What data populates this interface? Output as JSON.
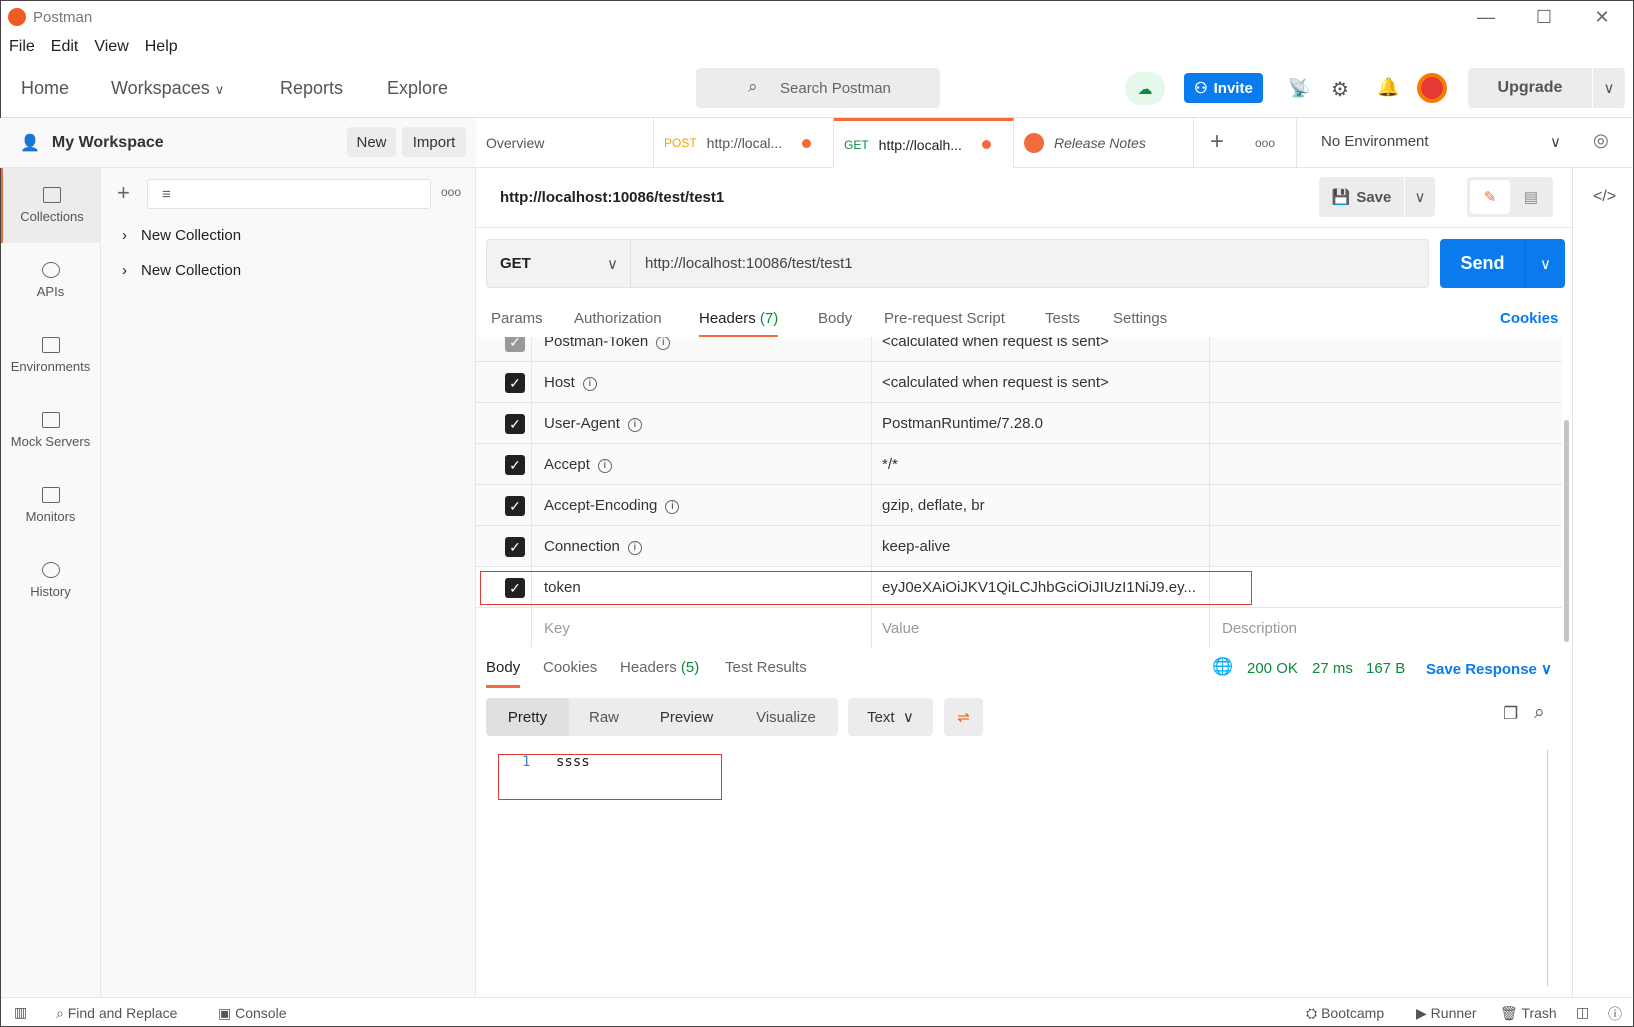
{
  "app": {
    "title": "Postman"
  },
  "menu": [
    "File",
    "Edit",
    "View",
    "Help"
  ],
  "nav": {
    "home": "Home",
    "workspaces": "Workspaces",
    "reports": "Reports",
    "explore": "Explore",
    "search_placeholder": "Search Postman",
    "invite": "Invite",
    "upgrade": "Upgrade"
  },
  "workspace": {
    "name": "My Workspace",
    "new": "New",
    "import": "Import"
  },
  "sidebar": [
    {
      "label": "Collections",
      "icon": "collections-icon"
    },
    {
      "label": "APIs",
      "icon": "apis-icon"
    },
    {
      "label": "Environments",
      "icon": "environments-icon"
    },
    {
      "label": "Mock Servers",
      "icon": "mock-servers-icon"
    },
    {
      "label": "Monitors",
      "icon": "monitors-icon"
    },
    {
      "label": "History",
      "icon": "history-icon"
    }
  ],
  "collections": [
    "New Collection",
    "New Collection"
  ],
  "tabs": [
    {
      "label": "Overview"
    },
    {
      "method": "POST",
      "label": "http://local..."
    },
    {
      "method": "GET",
      "label": "http://localh..."
    },
    {
      "label": "Release Notes"
    }
  ],
  "environment": "No Environment",
  "request": {
    "title": "http://localhost:10086/test/test1",
    "method": "GET",
    "url": "http://localhost:10086/test/test1",
    "save": "Save",
    "send": "Send"
  },
  "request_tabs": {
    "params": "Params",
    "authorization": "Authorization",
    "headers": "Headers",
    "headers_count": "(7)",
    "body": "Body",
    "prerequest": "Pre-request Script",
    "tests": "Tests",
    "settings": "Settings",
    "cookies": "Cookies"
  },
  "headers": [
    {
      "key": "Postman-Token",
      "value": "<calculated when request is sent>"
    },
    {
      "key": "Host",
      "value": "<calculated when request is sent>"
    },
    {
      "key": "User-Agent",
      "value": "PostmanRuntime/7.28.0"
    },
    {
      "key": "Accept",
      "value": "*/*"
    },
    {
      "key": "Accept-Encoding",
      "value": "gzip, deflate, br"
    },
    {
      "key": "Connection",
      "value": "keep-alive"
    },
    {
      "key": "token",
      "value": "eyJ0eXAiOiJKV1QiLCJhbGciOiJIUzI1NiJ9.ey..."
    }
  ],
  "headers_placeholder": {
    "key": "Key",
    "value": "Value",
    "description": "Description"
  },
  "response": {
    "tabs": {
      "body": "Body",
      "cookies": "Cookies",
      "headers": "Headers",
      "headers_count": "(5)",
      "tests": "Test Results"
    },
    "status": "200 OK",
    "time": "27 ms",
    "size": "167 B",
    "save": "Save Response",
    "views": [
      "Pretty",
      "Raw",
      "Preview",
      "Visualize"
    ],
    "format": "Text",
    "lines": [
      {
        "n": "1",
        "text": "ssss"
      }
    ]
  },
  "footer": {
    "find": "Find and Replace",
    "console": "Console",
    "bootcamp": "Bootcamp",
    "runner": "Runner",
    "trash": "Trash"
  },
  "colors": {
    "accent": "#f26b3a",
    "send": "#097bed",
    "success": "#0a8a3a",
    "highlight": "#e53935"
  }
}
